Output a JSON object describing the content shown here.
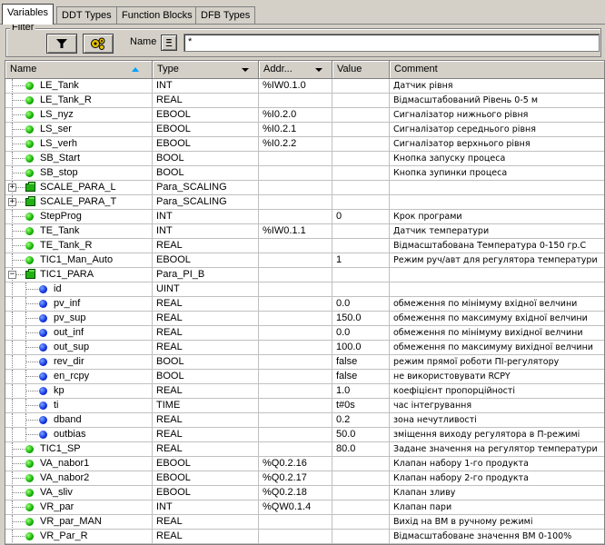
{
  "tabs": [
    {
      "label": "Variables",
      "active": true
    },
    {
      "label": "DDT Types",
      "active": false
    },
    {
      "label": "Function Blocks",
      "active": false
    },
    {
      "label": "DFB Types",
      "active": false
    }
  ],
  "filter": {
    "legend": "Filter",
    "name_label": "Name",
    "eq_label": "=",
    "name_value": "*"
  },
  "columns": {
    "name": "Name",
    "type": "Type",
    "address": "Addr...",
    "value": "Value",
    "comment": "Comment"
  },
  "rows": [
    {
      "name": "LE_Tank",
      "type": "INT",
      "address": "%IW0.1.0",
      "value": "",
      "comment": "Датчик рівня",
      "icon": "green-dot",
      "level": 0
    },
    {
      "name": "LE_Tank_R",
      "type": "REAL",
      "address": "",
      "value": "",
      "comment": "Відмасштабований Рівень 0-5 м",
      "icon": "green-dot",
      "level": 0
    },
    {
      "name": "LS_nyz",
      "type": "EBOOL",
      "address": "%I0.2.0",
      "value": "",
      "comment": "Сигналізатор нижнього рівня",
      "icon": "green-dot",
      "level": 0
    },
    {
      "name": "LS_ser",
      "type": "EBOOL",
      "address": "%I0.2.1",
      "value": "",
      "comment": "Сигналізатор середнього рівня",
      "icon": "green-dot",
      "level": 0
    },
    {
      "name": "LS_verh",
      "type": "EBOOL",
      "address": "%I0.2.2",
      "value": "",
      "comment": "Сигналізатор верхнього рівня",
      "icon": "green-dot",
      "level": 0
    },
    {
      "name": "SB_Start",
      "type": "BOOL",
      "address": "",
      "value": "",
      "comment": "Кнопка запуску процеса",
      "icon": "green-dot",
      "level": 0
    },
    {
      "name": "SB_stop",
      "type": "BOOL",
      "address": "",
      "value": "",
      "comment": "Кнопка зупинки процеса",
      "icon": "green-dot",
      "level": 0
    },
    {
      "name": "SCALE_PARA_L",
      "type": "Para_SCALING",
      "address": "",
      "value": "",
      "comment": "",
      "icon": "green-cube",
      "level": 0,
      "expander": "+"
    },
    {
      "name": "SCALE_PARA_T",
      "type": "Para_SCALING",
      "address": "",
      "value": "",
      "comment": "",
      "icon": "green-cube",
      "level": 0,
      "expander": "+"
    },
    {
      "name": "StepProg",
      "type": "INT",
      "address": "",
      "value": "0",
      "comment": "Крок програми",
      "icon": "green-dot",
      "level": 0
    },
    {
      "name": "TE_Tank",
      "type": "INT",
      "address": "%IW0.1.1",
      "value": "",
      "comment": "Датчик температури",
      "icon": "green-dot",
      "level": 0
    },
    {
      "name": "TE_Tank_R",
      "type": "REAL",
      "address": "",
      "value": "",
      "comment": "Відмасштабована Температура 0-150 гр.С",
      "icon": "green-dot",
      "level": 0
    },
    {
      "name": "TIC1_Man_Auto",
      "type": "EBOOL",
      "address": "",
      "value": "1",
      "comment": "Режим руч/авт для регулятора температури",
      "icon": "green-dot",
      "level": 0
    },
    {
      "name": "TIC1_PARA",
      "type": "Para_PI_B",
      "address": "",
      "value": "",
      "comment": "",
      "icon": "green-cube",
      "level": 0,
      "expander": "−"
    },
    {
      "name": "id",
      "type": "UINT",
      "address": "",
      "value": "",
      "comment": "",
      "icon": "blue-dot",
      "level": 1
    },
    {
      "name": "pv_inf",
      "type": "REAL",
      "address": "",
      "value": "0.0",
      "comment": "обмеження по мінімуму вхідної велчини",
      "icon": "blue-dot",
      "level": 1
    },
    {
      "name": "pv_sup",
      "type": "REAL",
      "address": "",
      "value": "150.0",
      "comment": "обмеження по максимуму вхідної велчини",
      "icon": "blue-dot",
      "level": 1
    },
    {
      "name": "out_inf",
      "type": "REAL",
      "address": "",
      "value": "0.0",
      "comment": "обмеження по мінімуму вихідної велчини",
      "icon": "blue-dot",
      "level": 1
    },
    {
      "name": "out_sup",
      "type": "REAL",
      "address": "",
      "value": "100.0",
      "comment": "обмеження по максимуму вихідної велчини",
      "icon": "blue-dot",
      "level": 1
    },
    {
      "name": "rev_dir",
      "type": "BOOL",
      "address": "",
      "value": "false",
      "comment": "режим прямої роботи ПІ-регулятору",
      "icon": "blue-dot",
      "level": 1
    },
    {
      "name": "en_rcpy",
      "type": "BOOL",
      "address": "",
      "value": "false",
      "comment": "не використовувати RCPY",
      "icon": "blue-dot",
      "level": 1
    },
    {
      "name": "kp",
      "type": "REAL",
      "address": "",
      "value": "1.0",
      "comment": "коефіцієнт пропорційності",
      "icon": "blue-dot",
      "level": 1
    },
    {
      "name": "ti",
      "type": "TIME",
      "address": "",
      "value": "t#0s",
      "comment": "час інтегрування",
      "icon": "blue-dot",
      "level": 1
    },
    {
      "name": "dband",
      "type": "REAL",
      "address": "",
      "value": "0.2",
      "comment": "зона нечутливості",
      "icon": "blue-dot",
      "level": 1
    },
    {
      "name": "outbias",
      "type": "REAL",
      "address": "",
      "value": "50.0",
      "comment": "зміщення виходу регулятора в П-режимі",
      "icon": "blue-dot",
      "level": 1
    },
    {
      "name": "TIC1_SP",
      "type": "REAL",
      "address": "",
      "value": "80.0",
      "comment": "Задане значення на регулятор температури",
      "icon": "green-dot",
      "level": 0
    },
    {
      "name": "VA_nabor1",
      "type": "EBOOL",
      "address": "%Q0.2.16",
      "value": "",
      "comment": "Клапан набору 1-го продукта",
      "icon": "green-dot",
      "level": 0
    },
    {
      "name": "VA_nabor2",
      "type": "EBOOL",
      "address": "%Q0.2.17",
      "value": "",
      "comment": "Клапан набору 2-го продукта",
      "icon": "green-dot",
      "level": 0
    },
    {
      "name": "VA_sliv",
      "type": "EBOOL",
      "address": "%Q0.2.18",
      "value": "",
      "comment": "Клапан зливу",
      "icon": "green-dot",
      "level": 0
    },
    {
      "name": "VR_par",
      "type": "INT",
      "address": "%QW0.1.4",
      "value": "",
      "comment": "Клапан пари",
      "icon": "green-dot",
      "level": 0
    },
    {
      "name": "VR_par_MAN",
      "type": "REAL",
      "address": "",
      "value": "",
      "comment": "Вихід на ВМ в ручному режимі",
      "icon": "green-dot",
      "level": 0
    },
    {
      "name": "VR_Par_R",
      "type": "REAL",
      "address": "",
      "value": "",
      "comment": "Відмасштабоване значення ВМ 0-100%",
      "icon": "green-dot",
      "level": 0
    }
  ]
}
